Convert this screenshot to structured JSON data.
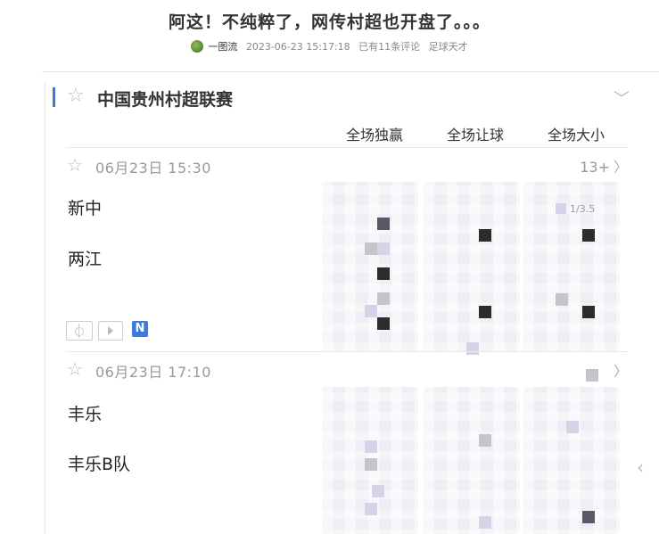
{
  "article": {
    "title": "阿这！不纯粹了，网传村超也开盘了。。。",
    "author": "一图流",
    "datetime": "2023-06-23 15:17:18",
    "comments": "已有11条评论",
    "category": "足球天才"
  },
  "league": {
    "name": "中国贵州村超联赛"
  },
  "columns": [
    "全场独赢",
    "全场让球",
    "全场大小"
  ],
  "matches": [
    {
      "datetime": "06月23日 15:30",
      "more": "13+",
      "home": "新中",
      "away": "两江",
      "hint": "1/3.5"
    },
    {
      "datetime": "06月23日 17:10",
      "more": "",
      "home": "丰乐",
      "away": "丰乐B队",
      "hint": ""
    }
  ],
  "badge_n": "N",
  "colors": {
    "accent": "#3b7be0",
    "odds_bg": "#eeeef4"
  },
  "icons": [
    "avatar-icon",
    "star-icon",
    "chevron-down-icon",
    "chevron-right-icon",
    "field-icon",
    "tv-play-icon"
  ]
}
